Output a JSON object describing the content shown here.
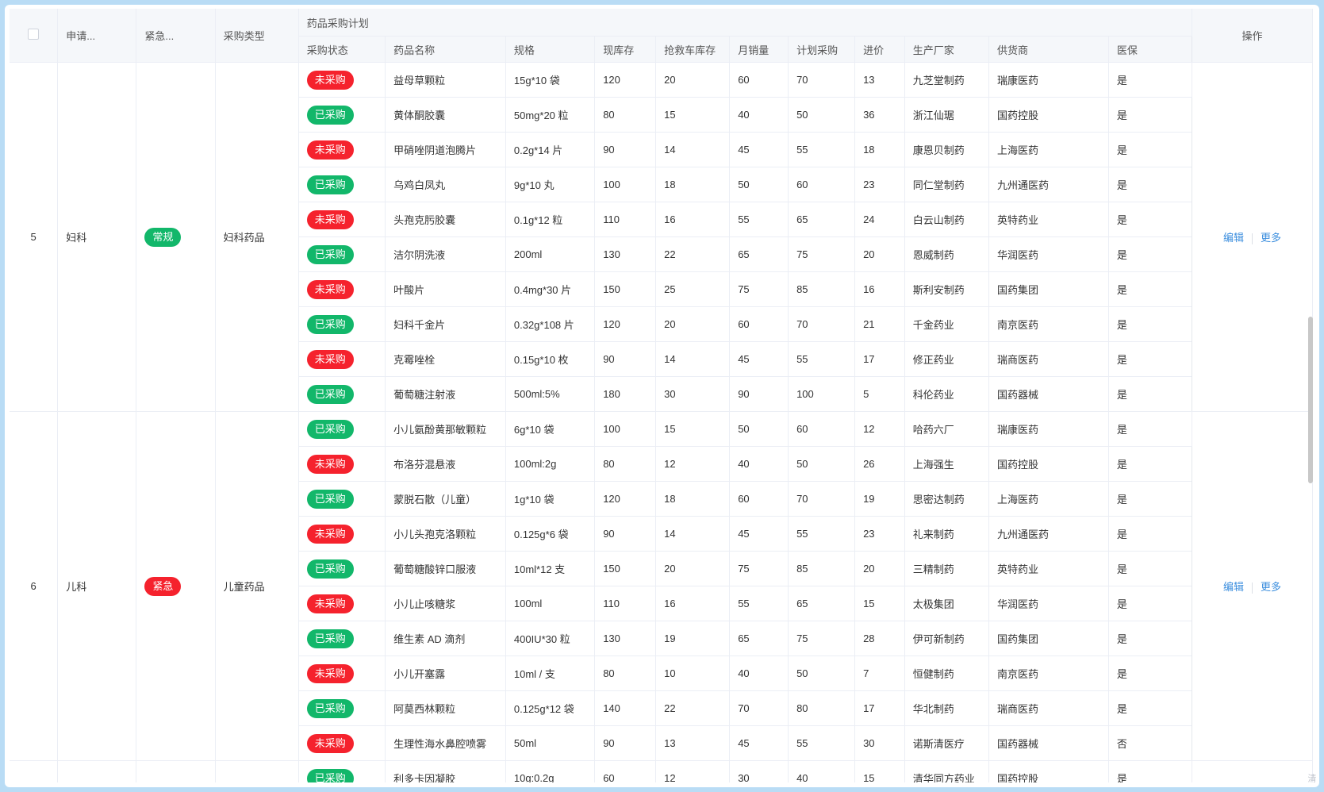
{
  "header": {
    "select_all": "",
    "applicant": "申请...",
    "urgency": "紧急...",
    "purchase_type": "采购类型",
    "group_title": "药品采购计划",
    "status": "采购状态",
    "drug_name": "药品名称",
    "spec": "规格",
    "stock": "现库存",
    "rescue_stock": "抢救车库存",
    "monthly_sales": "月销量",
    "plan_purchase": "计划采购",
    "price": "进价",
    "manufacturer": "生产厂家",
    "supplier": "供货商",
    "insurance": "医保",
    "operation": "操作"
  },
  "colors": {
    "not_purchased": "#f5222d",
    "purchased": "#12b76a",
    "link": "#3b8ede"
  },
  "groups": [
    {
      "id": "5",
      "department": "妇科",
      "urgency": "常规",
      "urgency_color": "green",
      "purchase_type": "妇科药品",
      "edit": "编辑",
      "more": "更多",
      "rows": [
        {
          "status": "未采购",
          "status_color": "red",
          "name": "益母草颗粒",
          "spec": "15g*10 袋",
          "stock": "120",
          "rescue": "20",
          "sales": "60",
          "plan": "70",
          "price": "13",
          "maker": "九芝堂制药",
          "supplier": "瑞康医药",
          "ins": "是"
        },
        {
          "status": "已采购",
          "status_color": "green",
          "name": "黄体酮胶囊",
          "spec": "50mg*20 粒",
          "stock": "80",
          "rescue": "15",
          "sales": "40",
          "plan": "50",
          "price": "36",
          "maker": "浙江仙琚",
          "supplier": "国药控股",
          "ins": "是"
        },
        {
          "status": "未采购",
          "status_color": "red",
          "name": "甲硝唑阴道泡腾片",
          "spec": "0.2g*14 片",
          "stock": "90",
          "rescue": "14",
          "sales": "45",
          "plan": "55",
          "price": "18",
          "maker": "康恩贝制药",
          "supplier": "上海医药",
          "ins": "是"
        },
        {
          "status": "已采购",
          "status_color": "green",
          "name": "乌鸡白凤丸",
          "spec": "9g*10 丸",
          "stock": "100",
          "rescue": "18",
          "sales": "50",
          "plan": "60",
          "price": "23",
          "maker": "同仁堂制药",
          "supplier": "九州通医药",
          "ins": "是"
        },
        {
          "status": "未采购",
          "status_color": "red",
          "name": "头孢克肟胶囊",
          "spec": "0.1g*12 粒",
          "stock": "110",
          "rescue": "16",
          "sales": "55",
          "plan": "65",
          "price": "24",
          "maker": "白云山制药",
          "supplier": "英特药业",
          "ins": "是"
        },
        {
          "status": "已采购",
          "status_color": "green",
          "name": "洁尔阴洗液",
          "spec": "200ml",
          "stock": "130",
          "rescue": "22",
          "sales": "65",
          "plan": "75",
          "price": "20",
          "maker": "恩威制药",
          "supplier": "华润医药",
          "ins": "是"
        },
        {
          "status": "未采购",
          "status_color": "red",
          "name": "叶酸片",
          "spec": "0.4mg*30 片",
          "stock": "150",
          "rescue": "25",
          "sales": "75",
          "plan": "85",
          "price": "16",
          "maker": "斯利安制药",
          "supplier": "国药集团",
          "ins": "是"
        },
        {
          "status": "已采购",
          "status_color": "green",
          "name": "妇科千金片",
          "spec": "0.32g*108 片",
          "stock": "120",
          "rescue": "20",
          "sales": "60",
          "plan": "70",
          "price": "21",
          "maker": "千金药业",
          "supplier": "南京医药",
          "ins": "是"
        },
        {
          "status": "未采购",
          "status_color": "red",
          "name": "克霉唑栓",
          "spec": "0.15g*10 枚",
          "stock": "90",
          "rescue": "14",
          "sales": "45",
          "plan": "55",
          "price": "17",
          "maker": "修正药业",
          "supplier": "瑞商医药",
          "ins": "是"
        },
        {
          "status": "已采购",
          "status_color": "green",
          "name": "葡萄糖注射液",
          "spec": "500ml:5%",
          "stock": "180",
          "rescue": "30",
          "sales": "90",
          "plan": "100",
          "price": "5",
          "maker": "科伦药业",
          "supplier": "国药器械",
          "ins": "是"
        }
      ]
    },
    {
      "id": "6",
      "department": "儿科",
      "urgency": "紧急",
      "urgency_color": "red",
      "purchase_type": "儿童药品",
      "edit": "编辑",
      "more": "更多",
      "rows": [
        {
          "status": "已采购",
          "status_color": "green",
          "name": "小儿氨酚黄那敏颗粒",
          "spec": "6g*10 袋",
          "stock": "100",
          "rescue": "15",
          "sales": "50",
          "plan": "60",
          "price": "12",
          "maker": "哈药六厂",
          "supplier": "瑞康医药",
          "ins": "是"
        },
        {
          "status": "未采购",
          "status_color": "red",
          "name": "布洛芬混悬液",
          "spec": "100ml:2g",
          "stock": "80",
          "rescue": "12",
          "sales": "40",
          "plan": "50",
          "price": "26",
          "maker": "上海强生",
          "supplier": "国药控股",
          "ins": "是"
        },
        {
          "status": "已采购",
          "status_color": "green",
          "name": "蒙脱石散（儿童）",
          "spec": "1g*10 袋",
          "stock": "120",
          "rescue": "18",
          "sales": "60",
          "plan": "70",
          "price": "19",
          "maker": "思密达制药",
          "supplier": "上海医药",
          "ins": "是"
        },
        {
          "status": "未采购",
          "status_color": "red",
          "name": "小儿头孢克洛颗粒",
          "spec": "0.125g*6 袋",
          "stock": "90",
          "rescue": "14",
          "sales": "45",
          "plan": "55",
          "price": "23",
          "maker": "礼来制药",
          "supplier": "九州通医药",
          "ins": "是"
        },
        {
          "status": "已采购",
          "status_color": "green",
          "name": "葡萄糖酸锌口服液",
          "spec": "10ml*12 支",
          "stock": "150",
          "rescue": "20",
          "sales": "75",
          "plan": "85",
          "price": "20",
          "maker": "三精制药",
          "supplier": "英特药业",
          "ins": "是"
        },
        {
          "status": "未采购",
          "status_color": "red",
          "name": "小儿止咳糖浆",
          "spec": "100ml",
          "stock": "110",
          "rescue": "16",
          "sales": "55",
          "plan": "65",
          "price": "15",
          "maker": "太极集团",
          "supplier": "华润医药",
          "ins": "是"
        },
        {
          "status": "已采购",
          "status_color": "green",
          "name": "维生素 AD 滴剂",
          "spec": "400IU*30 粒",
          "stock": "130",
          "rescue": "19",
          "sales": "65",
          "plan": "75",
          "price": "28",
          "maker": "伊可新制药",
          "supplier": "国药集团",
          "ins": "是"
        },
        {
          "status": "未采购",
          "status_color": "red",
          "name": "小儿开塞露",
          "spec": "10ml / 支",
          "stock": "80",
          "rescue": "10",
          "sales": "40",
          "plan": "50",
          "price": "7",
          "maker": "恒健制药",
          "supplier": "南京医药",
          "ins": "是"
        },
        {
          "status": "已采购",
          "status_color": "green",
          "name": "阿莫西林颗粒",
          "spec": "0.125g*12 袋",
          "stock": "140",
          "rescue": "22",
          "sales": "70",
          "plan": "80",
          "price": "17",
          "maker": "华北制药",
          "supplier": "瑞商医药",
          "ins": "是"
        },
        {
          "status": "未采购",
          "status_color": "red",
          "name": "生理性海水鼻腔喷雾",
          "spec": "50ml",
          "stock": "90",
          "rescue": "13",
          "sales": "45",
          "plan": "55",
          "price": "30",
          "maker": "诺斯清医疗",
          "supplier": "国药器械",
          "ins": "否"
        }
      ]
    },
    {
      "id": "",
      "department": "",
      "urgency": "",
      "urgency_color": "",
      "purchase_type": "",
      "edit": "",
      "more": "",
      "rows": [
        {
          "status": "已采购",
          "status_color": "green",
          "name": "利多卡因凝胶",
          "spec": "10g:0.2g",
          "stock": "60",
          "rescue": "12",
          "sales": "30",
          "plan": "40",
          "price": "15",
          "maker": "清华同方药业",
          "supplier": "国药控股",
          "ins": "是"
        }
      ]
    }
  ],
  "side_note": "清"
}
